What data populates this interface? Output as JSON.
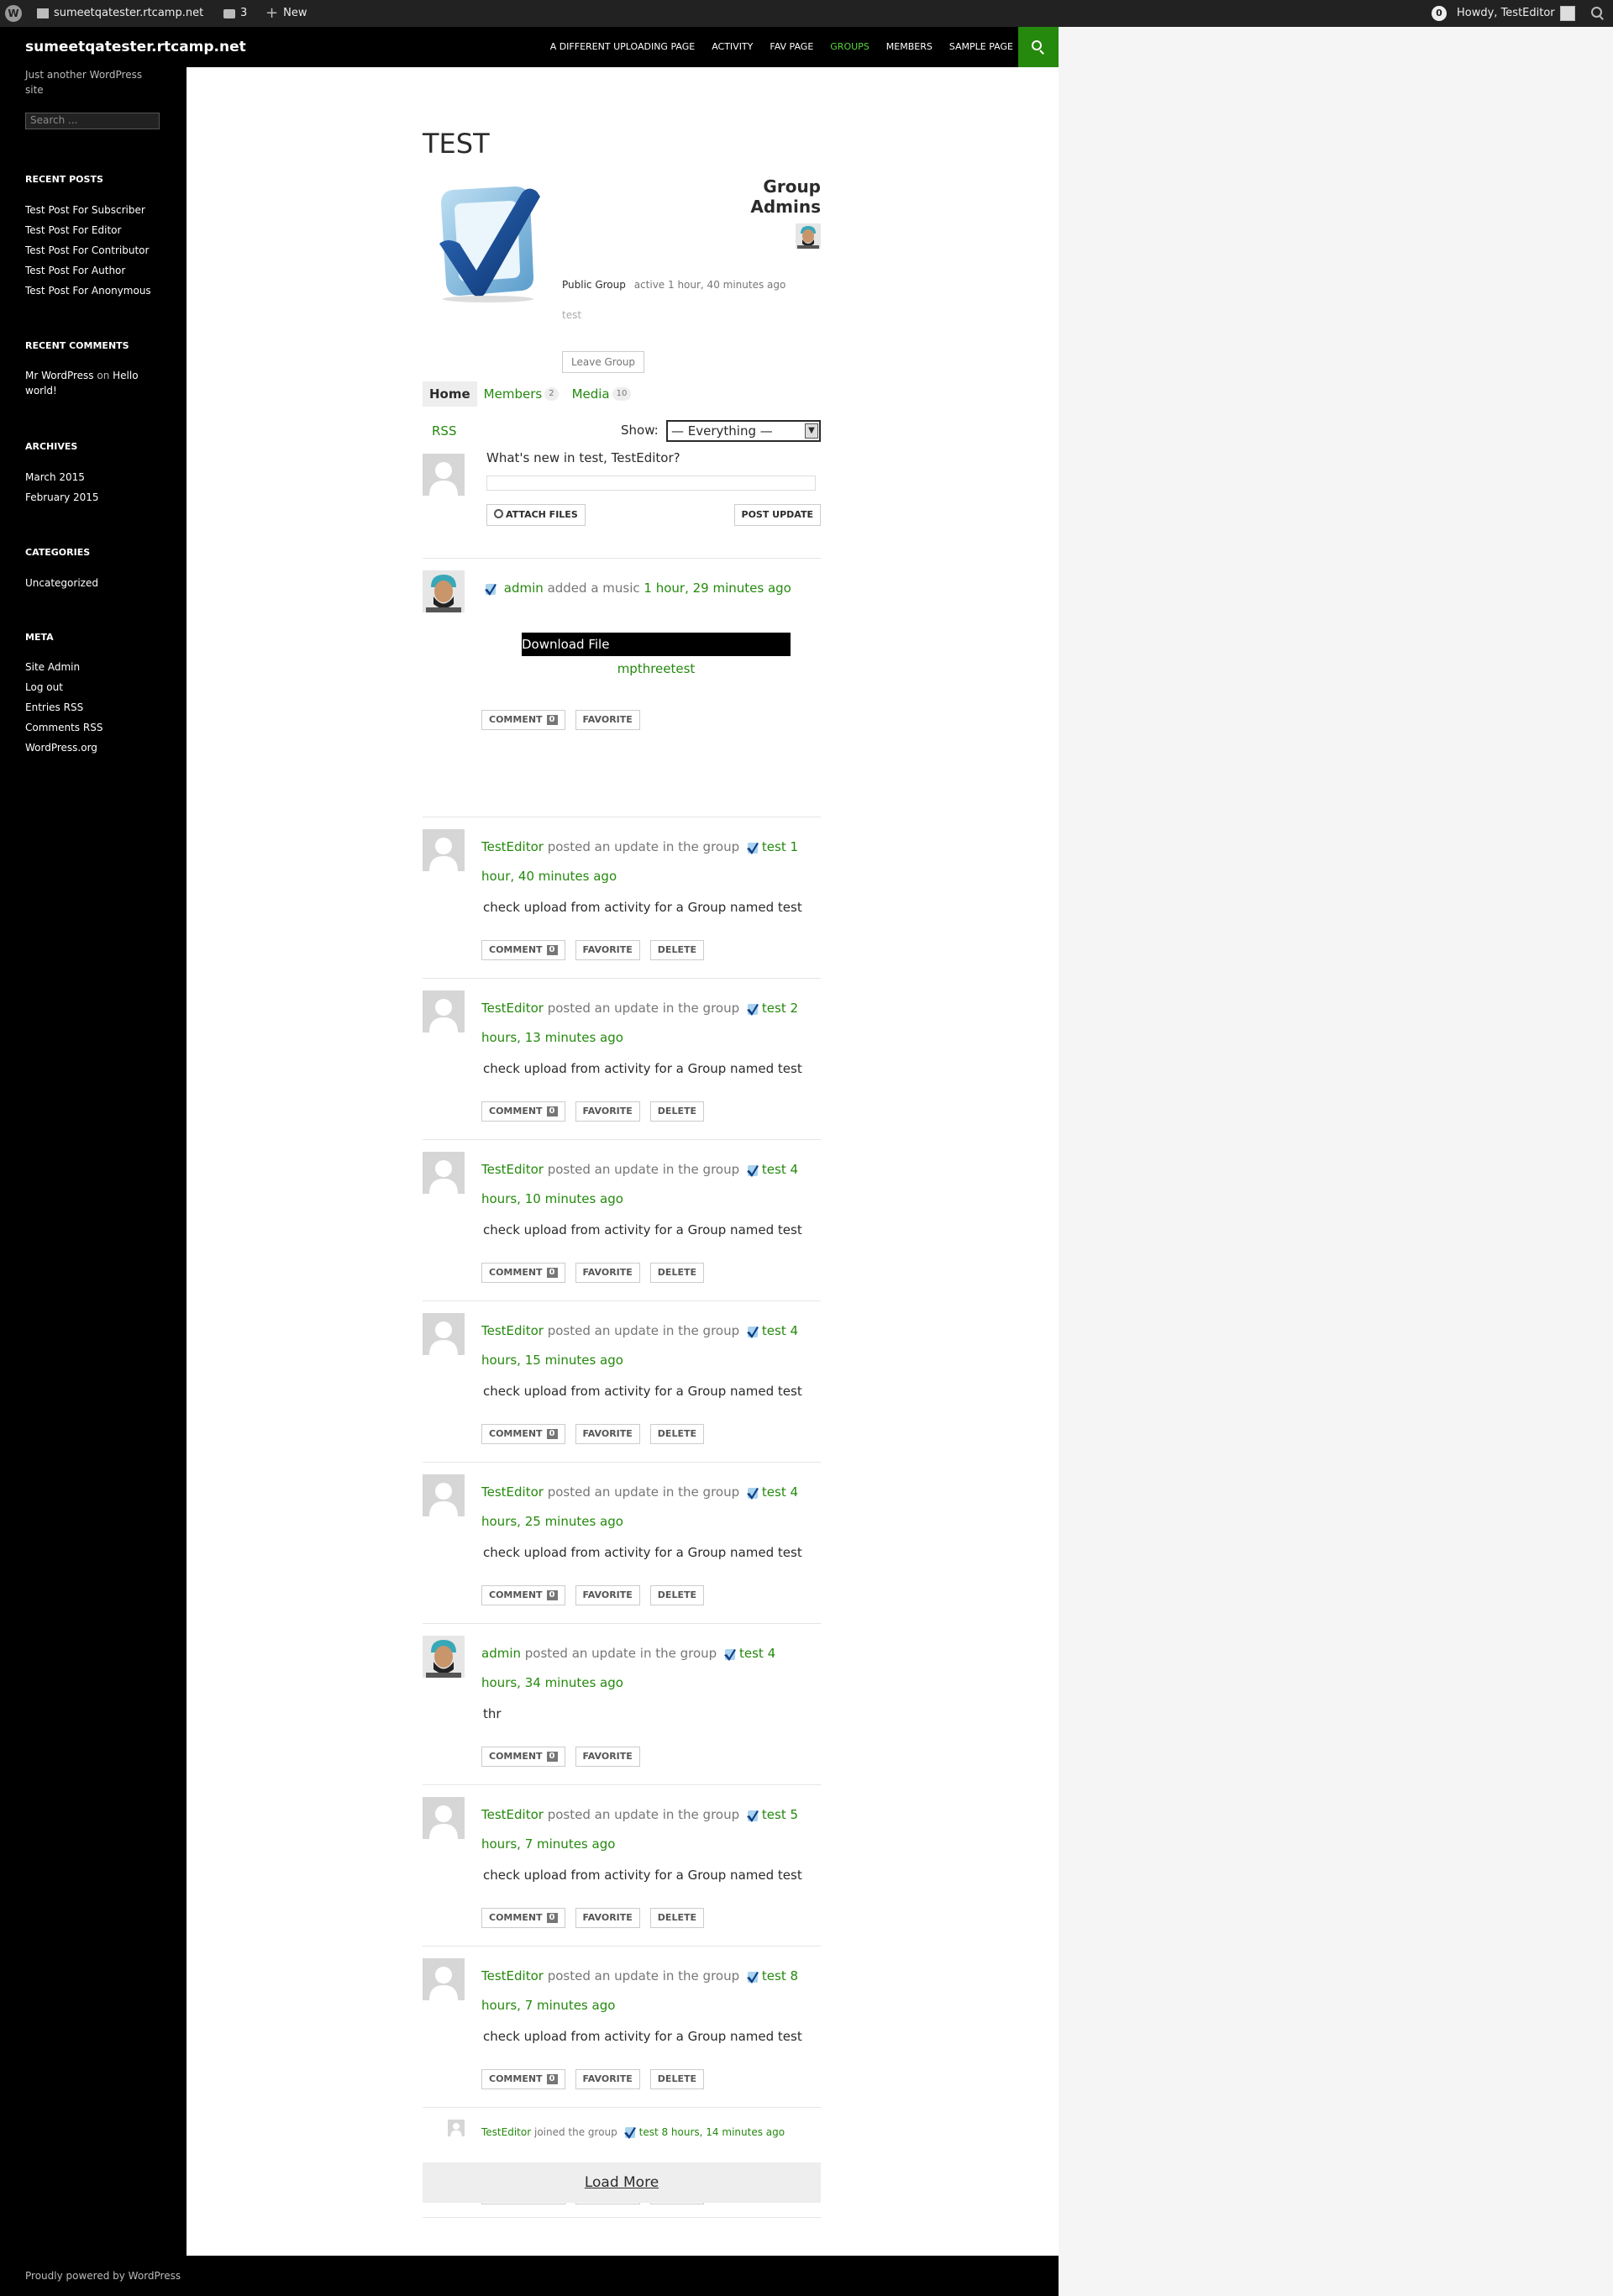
{
  "admin_bar": {
    "site_name": "sumeetqatester.rtcamp.net",
    "comments_count": "3",
    "new_label": "New",
    "notifications": "0",
    "greeting": "Howdy, TestEditor"
  },
  "header": {
    "site_title": "sumeetqatester.rtcamp.net",
    "nav": [
      {
        "label": "A DIFFERENT UPLOADING PAGE"
      },
      {
        "label": "ACTIVITY"
      },
      {
        "label": "FAV PAGE"
      },
      {
        "label": "GROUPS",
        "active": true
      },
      {
        "label": "MEMBERS"
      },
      {
        "label": "SAMPLE PAGE"
      }
    ]
  },
  "sidebar": {
    "tagline": "Just another WordPress site",
    "search_placeholder": "Search ...",
    "recent_posts": {
      "title": "RECENT POSTS",
      "items": [
        "Test Post For Subscriber",
        "Test Post For Editor",
        "Test Post For Contributor",
        "Test Post For Author",
        "Test Post For Anonymous"
      ]
    },
    "recent_comments": {
      "title": "RECENT COMMENTS",
      "author": "Mr WordPress",
      "on": "on",
      "post": "Hello world!"
    },
    "archives": {
      "title": "ARCHIVES",
      "items": [
        "March 2015",
        "February 2015"
      ]
    },
    "categories": {
      "title": "CATEGORIES",
      "items": [
        "Uncategorized"
      ]
    },
    "meta": {
      "title": "META",
      "items": [
        "Site Admin",
        "Log out",
        "Entries RSS",
        "Comments RSS",
        "WordPress.org"
      ]
    }
  },
  "group": {
    "title": "TEST",
    "admins_title": "Group Admins",
    "type": "Public Group",
    "active": "active 1 hour, 40 minutes ago",
    "description": "test",
    "leave_label": "Leave Group",
    "tabs": [
      {
        "label": "Home"
      },
      {
        "label": "Members",
        "count": "2"
      },
      {
        "label": "Media",
        "count": "10"
      }
    ],
    "rss_label": "RSS",
    "show_label": "Show:",
    "show_value": "— Everything —",
    "whats_new": "What's new in test, TestEditor?",
    "attach_label": "ATTACH FILES",
    "post_label": "POST UPDATE"
  },
  "activities": [
    {
      "author": "admin",
      "action": "added a music",
      "group": "",
      "time": "1 hour, 29 minutes ago",
      "download_label": "Download File",
      "track": "mpthreetest",
      "comments": "0",
      "deletable": false
    },
    {
      "author": "TestEditor",
      "action": "posted an update in the group",
      "group": "test",
      "time": "1 hour, 40 minutes ago",
      "text": "check upload from activity for a Group named test",
      "comments": "0",
      "deletable": true
    },
    {
      "author": "TestEditor",
      "action": "posted an update in the group",
      "group": "test",
      "time": "2 hours, 13 minutes ago",
      "text": "check upload from activity for a Group named test",
      "comments": "0",
      "deletable": true
    },
    {
      "author": "TestEditor",
      "action": "posted an update in the group",
      "group": "test",
      "time": "4 hours, 10 minutes ago",
      "text": "check upload from activity for a Group named test",
      "comments": "0",
      "deletable": true
    },
    {
      "author": "TestEditor",
      "action": "posted an update in the group",
      "group": "test",
      "time": "4 hours, 15 minutes ago",
      "text": "check upload from activity for a Group named test",
      "comments": "0",
      "deletable": true
    },
    {
      "author": "TestEditor",
      "action": "posted an update in the group",
      "group": "test",
      "time": "4 hours, 25 minutes ago",
      "text": "check upload from activity for a Group named test",
      "comments": "0",
      "deletable": true
    },
    {
      "author": "admin",
      "action": "posted an update in the group",
      "group": "test",
      "time": "4 hours, 34 minutes ago",
      "text": "thr",
      "comments": "0",
      "deletable": false
    },
    {
      "author": "TestEditor",
      "action": "posted an update in the group",
      "group": "test",
      "time": "5 hours, 7 minutes ago",
      "text": "check upload from activity for a Group named test",
      "comments": "0",
      "deletable": true
    },
    {
      "author": "TestEditor",
      "action": "posted an update in the group",
      "group": "test",
      "time": "8 hours, 7 minutes ago",
      "text": "check upload from activity for a Group named test",
      "comments": "0",
      "deletable": true
    },
    {
      "author": "TestEditor",
      "action": "joined the group",
      "group": "test",
      "time": "8 hours, 14 minutes ago",
      "comments": "0",
      "deletable": true
    }
  ],
  "buttons": {
    "comment": "COMMENT",
    "favorite": "FAVORITE",
    "delete": "DELETE"
  },
  "load_more": "Load More",
  "footer": {
    "text": "Proudly powered by WordPress"
  },
  "colors": {
    "accent": "#24890d",
    "nav_active": "#55d737",
    "dark": "#000000"
  }
}
